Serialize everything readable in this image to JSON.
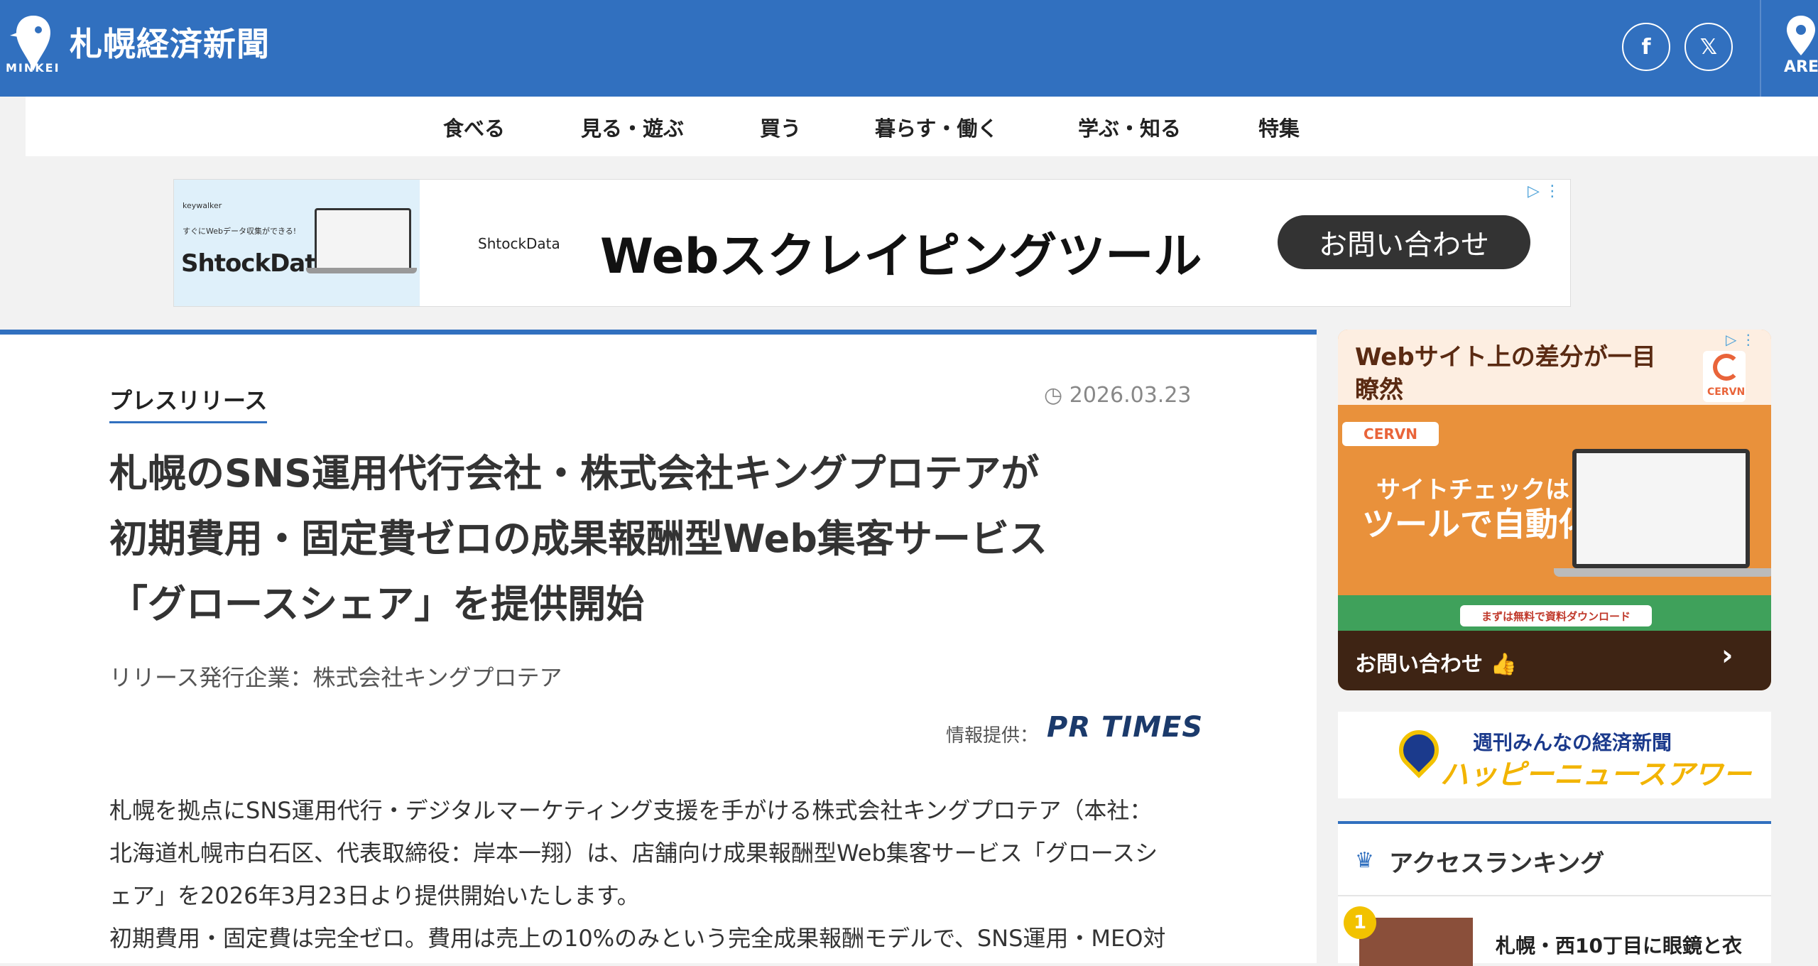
{
  "header": {
    "site_title": "札幌経済新聞",
    "brand_small": "MINKEI",
    "facebook_glyph": "f",
    "x_glyph": "𝕏",
    "area_label": "ARE"
  },
  "nav": {
    "items": [
      "食べる",
      "見る・遊ぶ",
      "買う",
      "暮らす・働く",
      "学ぶ・知る",
      "特集"
    ]
  },
  "top_ad": {
    "small_brand": "keywalker",
    "small_tagline": "すぐにWebデータ収集ができる!",
    "big_brand": "ShtockData",
    "brand_small": "ShtockData",
    "headline": "Webスクレイピングツール",
    "cta": "お問い合わせ",
    "info_glyph": "▷ ⋮"
  },
  "article": {
    "category": "プレスリリース",
    "date": "2026.03.23",
    "title_lines": [
      "札幌のSNS運用代行会社・株式会社キングプロテアが",
      "初期費用・固定費ゼロの成果報酬型Web集客サービス",
      "「グロースシェア」を提供開始"
    ],
    "issuer": "リリース発行企業：株式会社キングプロテア",
    "provider_label": "情報提供：",
    "provider_logo": "PR TIMES",
    "body_lines": [
      "札幌を拠点にSNS運用代行・デジタルマーケティング支援を手がける株式会社キングプロテア（本社：",
      "北海道札幌市白石区、代表取締役：岸本一翔）は、店舗向け成果報酬型Web集客サービス「グロースシ",
      "ェア」を2026年3月23日より提供開始いたします。",
      "初期費用・固定費は完全ゼロ。費用は売上の10%のみという完全成果報酬モデルで、SNS運用・MEO対"
    ]
  },
  "side_ad": {
    "top_text": "Webサイト上の差分が一目瞭然",
    "logo_text": "CERVN",
    "badge": "CERVN",
    "mid_line1": "サイトチェックは",
    "mid_line2": "ツールで自動化",
    "green_button": "まずは無料で資料ダウンロード",
    "bottom_text": "お問い合わせ 👍",
    "arrow": "›",
    "info_glyph": "▷ ⋮"
  },
  "happy_news": {
    "line1": "週刊みんなの経済新聞",
    "line2": "ハッピーニュースアワー"
  },
  "ranking": {
    "title": "アクセスランキング",
    "items": [
      {
        "rank": "1",
        "title": "札幌・西10丁目に眼鏡と衣"
      }
    ]
  },
  "colors": {
    "brand_blue": "#3170bf",
    "ad_cta_dark": "#333333",
    "side_orange": "#e9913b",
    "side_green": "#3fa15b",
    "side_brown": "#3e2414",
    "rank_gold": "#f2c200"
  }
}
